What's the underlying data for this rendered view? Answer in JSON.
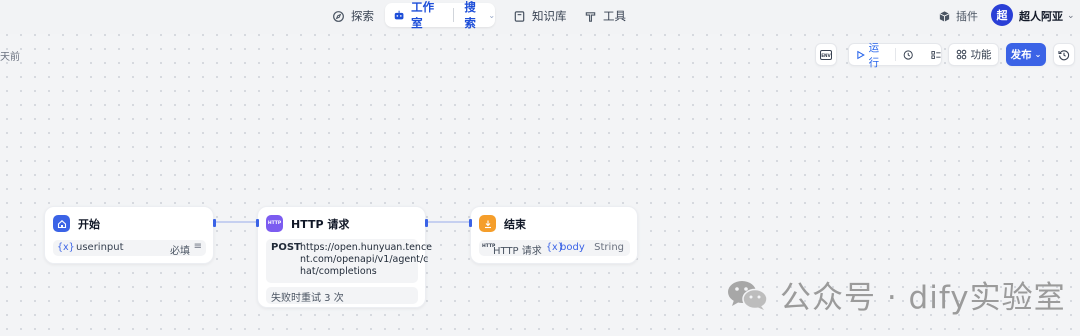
{
  "nav": {
    "explore": "探索",
    "studio": "工作室",
    "studio_sub": "搜索",
    "knowledge": "知识库",
    "tools": "工具",
    "plugins": "插件",
    "avatar_initial": "超",
    "username": "超人阿亚"
  },
  "canvas": {
    "edge_text": "天前"
  },
  "toolbar": {
    "env_label": "ENV",
    "run_label": "运行",
    "features_label": "功能",
    "publish_label": "发布"
  },
  "nodes": {
    "start": {
      "title": "开始",
      "var_prefix": "{x}",
      "var_name": "userinput",
      "required": "必填"
    },
    "http": {
      "badge": "HTTP",
      "title": "HTTP 请求",
      "method": "POST",
      "url_lines": [
        "https://open.hunyuan.tence",
        "nt.com/openapi/v1/agent/c",
        "hat/completions"
      ],
      "retry": "失败时重试 3 次"
    },
    "end": {
      "title": "结束",
      "source_badge": "HTTP",
      "source_node": "HTTP 请求",
      "var_prefix": "{x}",
      "var_name": "body",
      "type": "String"
    }
  },
  "watermark": {
    "text": "公众号 · dify实验室"
  },
  "colors": {
    "accent": "#3b63e6",
    "start_icon": "#3b63e6",
    "http_icon": "#7c5cf0",
    "end_icon": "#f59e2b"
  }
}
